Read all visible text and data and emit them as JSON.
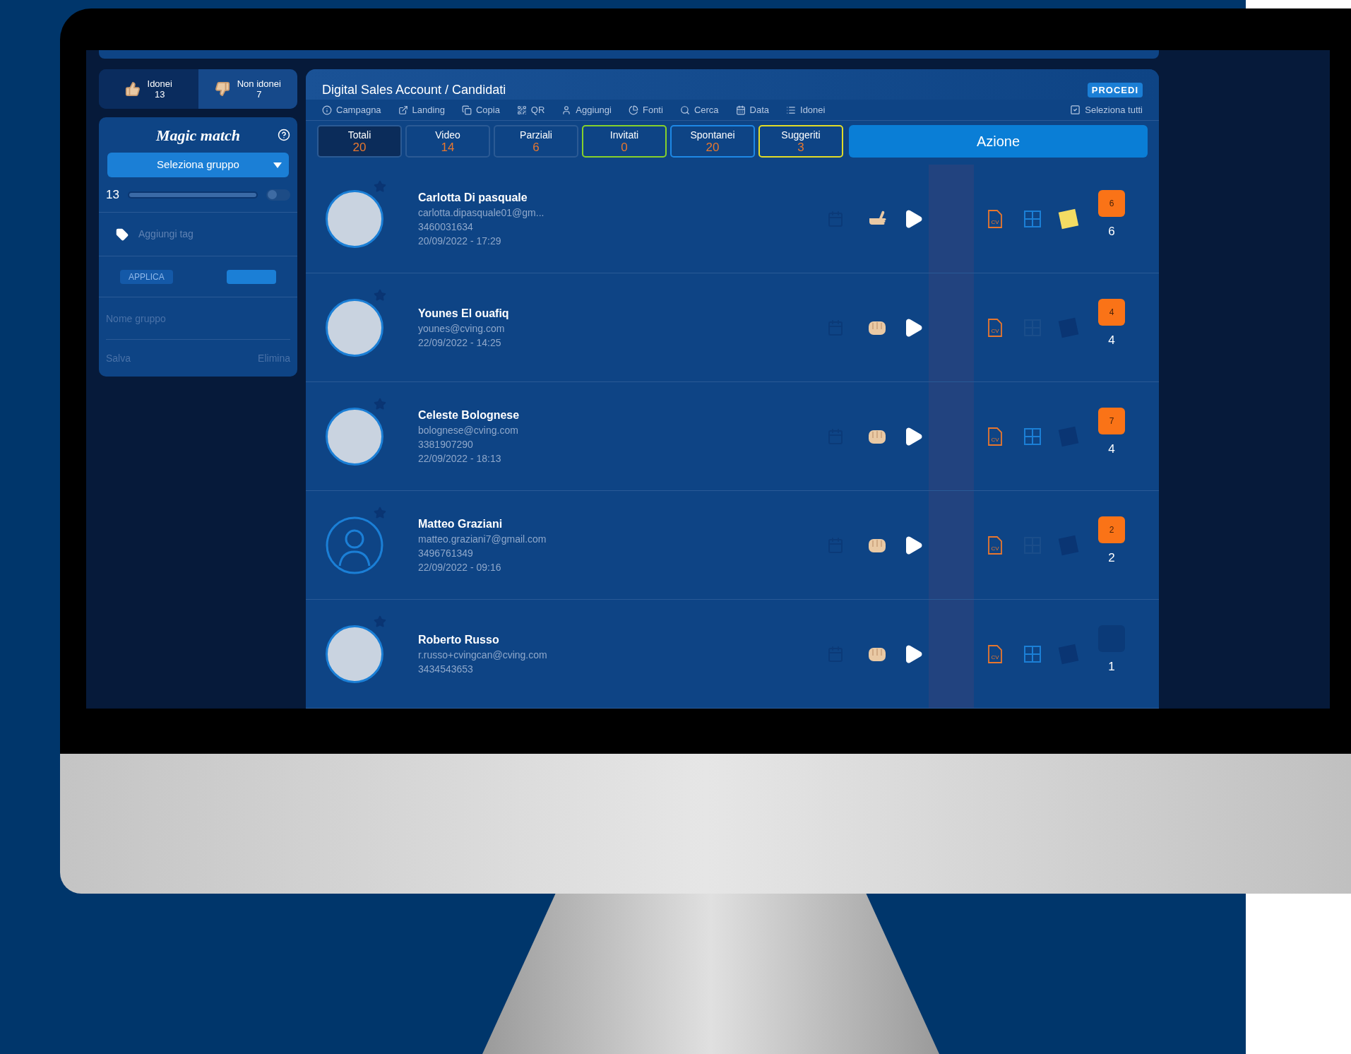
{
  "sidebar": {
    "filter_tabs": [
      {
        "label": "Idonei",
        "count": "13",
        "selected": true,
        "kind": "up"
      },
      {
        "label": "Non idonei",
        "count": "7",
        "selected": false,
        "kind": "down"
      }
    ],
    "magic_match": {
      "title": "Magic match",
      "group_select": "Seleziona gruppo",
      "slider_value": "13",
      "slider": {
        "level": 1
      },
      "toggle_on": false,
      "tag_placeholder": "Aggiungi tag",
      "apply_button": "APPLICA",
      "group_name_placeholder": "Nome gruppo",
      "save": "Salva",
      "delete": "Elimina"
    }
  },
  "main": {
    "title": "Digital Sales Account / Candidati",
    "proceed_button": "PROCEDI",
    "toolbar": [
      {
        "kind": "info",
        "label": "Campagna"
      },
      {
        "kind": "link",
        "label": "Landing"
      },
      {
        "kind": "copy",
        "label": "Copia"
      },
      {
        "kind": "qr",
        "label": "QR"
      },
      {
        "kind": "user",
        "label": "Aggiungi"
      },
      {
        "kind": "pie",
        "label": "Fonti"
      },
      {
        "kind": "search",
        "label": "Cerca"
      },
      {
        "kind": "calendar",
        "label": "Data"
      },
      {
        "kind": "list",
        "label": "Idonei"
      }
    ],
    "select_all": "Seleziona tutti",
    "stat_tabs": [
      {
        "label": "Totali",
        "count": "20",
        "selected": true,
        "color": "#2b5a94"
      },
      {
        "label": "Video",
        "count": "14",
        "selected": false,
        "color": "#2b5a94"
      },
      {
        "label": "Parziali",
        "count": "6",
        "selected": false,
        "color": "#2b5a94"
      },
      {
        "label": "Invitati",
        "count": "0",
        "selected": false,
        "color": "#86d12b"
      },
      {
        "label": "Spontanei",
        "count": "20",
        "selected": false,
        "color": "#1e88e5"
      },
      {
        "label": "Suggeriti",
        "count": "3",
        "selected": false,
        "color": "#e2dc27"
      }
    ],
    "action_button": "Azione",
    "candidates": [
      {
        "name": "Carlotta Di pasquale",
        "email": "carlotta.dipasquale01@gm...",
        "phone": "3460031634",
        "date": "20/09/2022 - 17:29",
        "avatar": {
          "kind": "photo"
        },
        "gesture": {
          "kind": "call"
        },
        "cv_label": "CV",
        "puzzle_active": true,
        "note_active": true,
        "badge_on": true,
        "badge": "6",
        "score": "6"
      },
      {
        "name": "Younes El ouafiq",
        "email": "younes@cving.com",
        "date": "22/09/2022 - 14:25",
        "avatar": {
          "kind": "photo"
        },
        "gesture": {
          "kind": "fist"
        },
        "cv_label": "CV",
        "puzzle_active": false,
        "note_active": false,
        "badge_on": true,
        "badge": "4",
        "score": "4"
      },
      {
        "name": "Celeste Bolognese",
        "email": "bolognese@cving.com",
        "phone": "3381907290",
        "date": "22/09/2022 - 18:13",
        "avatar": {
          "kind": "photo"
        },
        "gesture": {
          "kind": "fist"
        },
        "cv_label": "CV",
        "puzzle_active": true,
        "note_active": false,
        "badge_on": true,
        "badge": "7",
        "score": "4"
      },
      {
        "name": "Matteo Graziani",
        "email": "matteo.graziani7@gmail.com",
        "phone": "3496761349",
        "date": "22/09/2022 - 09:16",
        "avatar": {
          "kind": "placeholder"
        },
        "gesture": {
          "kind": "fist"
        },
        "cv_label": "CV",
        "puzzle_active": false,
        "note_active": false,
        "badge_on": true,
        "badge": "2",
        "score": "2"
      },
      {
        "name": "Roberto Russo",
        "email": "r.russo+cvingcan@cving.com",
        "phone": "3434543653",
        "avatar": {
          "kind": "photo"
        },
        "gesture": {
          "kind": "fist"
        },
        "cv_label": "CV",
        "puzzle_active": true,
        "note_active": false,
        "badge_on": false,
        "score": "1"
      }
    ]
  }
}
